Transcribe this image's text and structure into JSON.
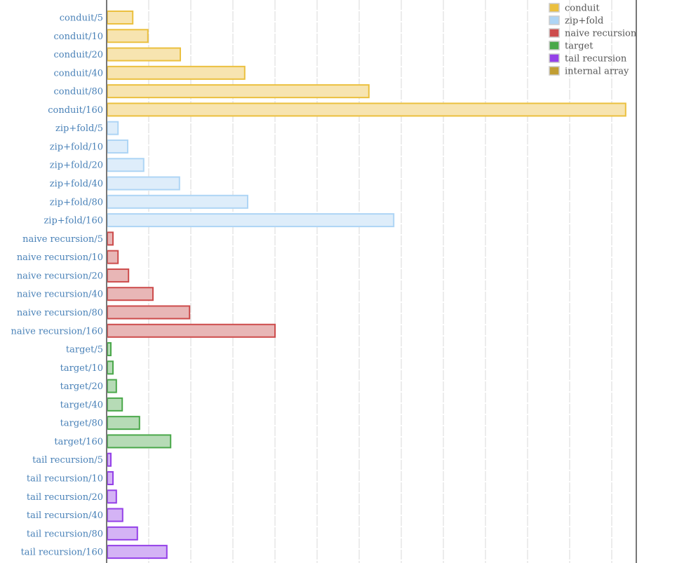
{
  "chart_data": {
    "type": "bar",
    "orientation": "horizontal",
    "title": "",
    "xlabel": "",
    "ylabel": "",
    "xlim": [
      0,
      12.6
    ],
    "grid": true,
    "grid_step": 1,
    "legend_position": "top-right",
    "categories": [
      "conduit/5",
      "conduit/10",
      "conduit/20",
      "conduit/40",
      "conduit/80",
      "conduit/160",
      "zip+fold/5",
      "zip+fold/10",
      "zip+fold/20",
      "zip+fold/40",
      "zip+fold/80",
      "zip+fold/160",
      "naive recursion/5",
      "naive recursion/10",
      "naive recursion/20",
      "naive recursion/40",
      "naive recursion/80",
      "naive recursion/160",
      "target/5",
      "target/10",
      "target/20",
      "target/40",
      "target/80",
      "target/160",
      "tail recursion/5",
      "tail recursion/10",
      "tail recursion/20",
      "tail recursion/40",
      "tail recursion/80",
      "tail recursion/160"
    ],
    "series": [
      {
        "name": "conduit",
        "color": "#ebc03f",
        "fill": "#f7e4b0",
        "values": [
          0.62,
          0.98,
          1.75,
          3.28,
          6.23,
          12.33
        ]
      },
      {
        "name": "zip+fold",
        "color": "#aed5f5",
        "fill": "#deedfa",
        "values": [
          0.27,
          0.5,
          0.88,
          1.73,
          3.35,
          6.82
        ]
      },
      {
        "name": "naive recursion",
        "color": "#cd4c4c",
        "fill": "#e8b6b6",
        "values": [
          0.15,
          0.27,
          0.52,
          1.1,
          1.97,
          4.0
        ]
      },
      {
        "name": "target",
        "color": "#4aa84a",
        "fill": "#b6dbb6",
        "values": [
          0.1,
          0.15,
          0.23,
          0.37,
          0.78,
          1.52
        ]
      },
      {
        "name": "tail recursion",
        "color": "#9440e8",
        "fill": "#d4b3f5",
        "values": [
          0.1,
          0.15,
          0.23,
          0.38,
          0.73,
          1.43
        ]
      },
      {
        "name": "internal array",
        "color": "#c19e33",
        "fill": "#c19e33",
        "values": []
      }
    ]
  }
}
